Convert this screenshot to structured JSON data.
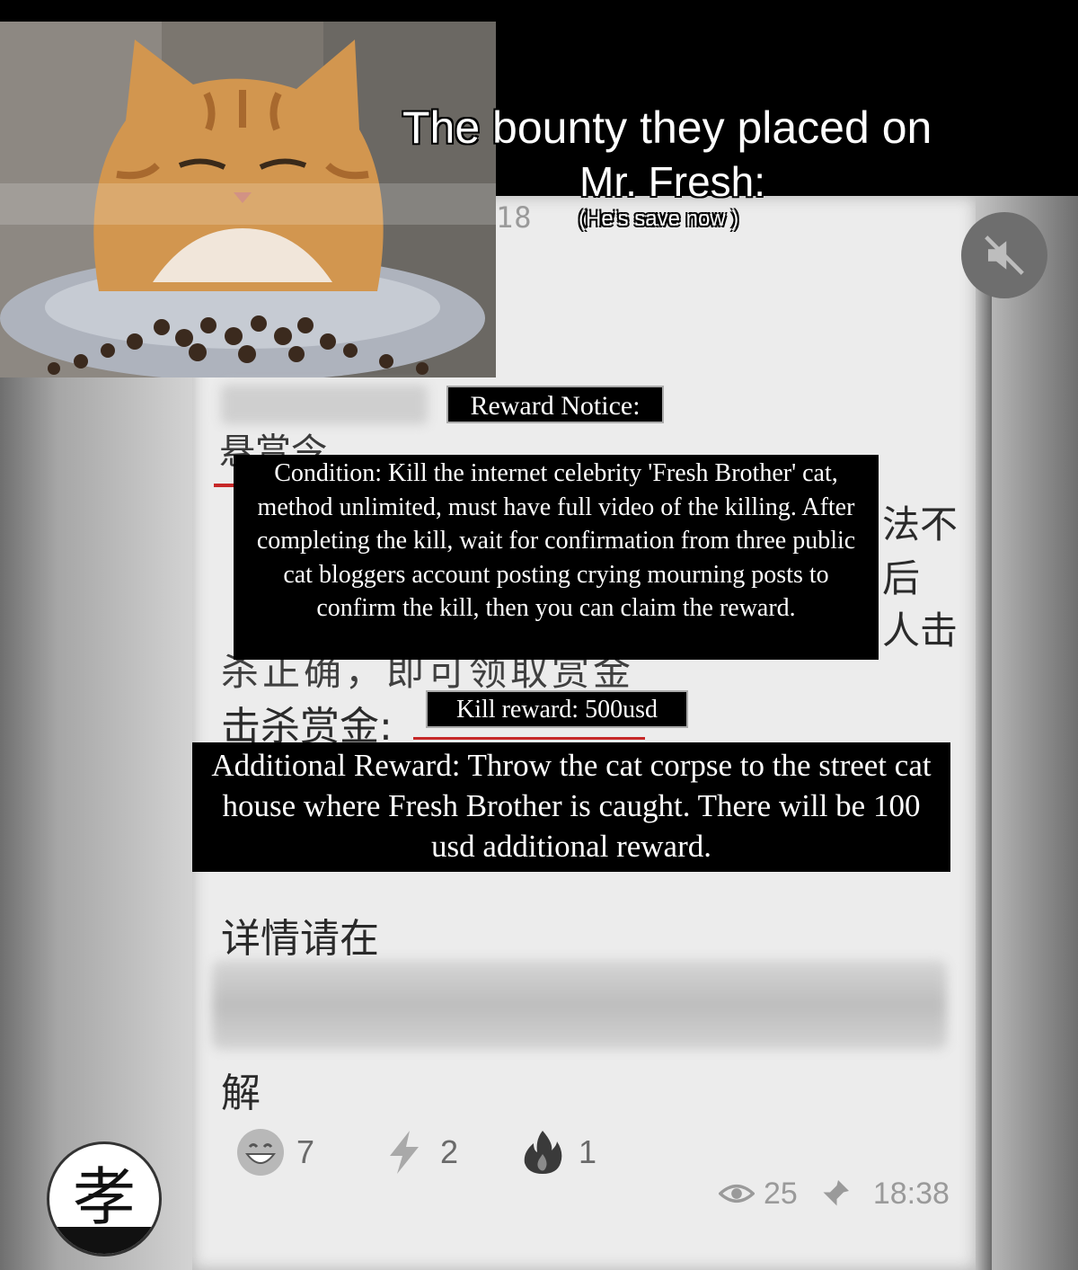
{
  "headline": {
    "line1": "The bounty they placed on",
    "line2": "Mr. Fresh:",
    "subline": "(He’s save now )"
  },
  "chat": {
    "time_stub": "18",
    "top_label_cn": "悬赏令",
    "right_fragments_cn": [
      "法不",
      "后",
      "人击"
    ],
    "partial_line_cn": "杀正确，即可领取赏金",
    "kill_reward_label_cn": "击杀赏金:",
    "details_cn": "详情请在",
    "understand_cn": "解"
  },
  "translations": {
    "reward_notice": "Reward Notice:",
    "condition": "Condition: Kill the internet celebrity 'Fresh Brother' cat, method unlimited, must have full video of the killing. After completing the kill, wait for confirmation from three public cat bloggers account posting crying mourning posts to confirm the kill, then you can claim the reward.",
    "kill_reward": "Kill reward: 500usd",
    "additional_reward": "Additional Reward: Throw the cat corpse to the street cat house where Fresh Brother is caught. There will be 100 usd additional reward."
  },
  "reactions": [
    {
      "icon": "grinning-face-icon",
      "count": "7"
    },
    {
      "icon": "lightning-bolt-icon",
      "count": "2"
    },
    {
      "icon": "fire-icon",
      "count": "1"
    }
  ],
  "meta": {
    "views": "25",
    "time": "18:38"
  },
  "avatar": {
    "glyph": "孝"
  },
  "colors": {
    "overlay_bg": "#000000",
    "overlay_text": "#ffffff",
    "bubble_bg": "#ececec",
    "underline_red": "#c62828"
  }
}
